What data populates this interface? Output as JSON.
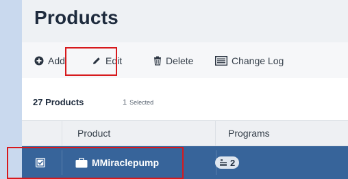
{
  "page": {
    "title": "Products"
  },
  "toolbar": {
    "add_label": "Add",
    "edit_label": "Edit",
    "delete_label": "Delete",
    "changelog_label": "Change Log"
  },
  "summary": {
    "count_text": "27 Products",
    "selected_count": "1",
    "selected_label": "Selected"
  },
  "table": {
    "columns": [
      "Product",
      "Programs"
    ],
    "rows": [
      {
        "checked": true,
        "product": "MMiraclepump",
        "programs": "2"
      }
    ]
  },
  "colors": {
    "accent": "#37649a",
    "highlight": "#d7191c",
    "title": "#1e2b3d"
  },
  "icons": {
    "add": "plus-circle-icon",
    "edit": "pencil-icon",
    "delete": "trash-icon",
    "changelog": "list-icon",
    "product": "briefcase-icon",
    "programs": "stack-icon"
  }
}
